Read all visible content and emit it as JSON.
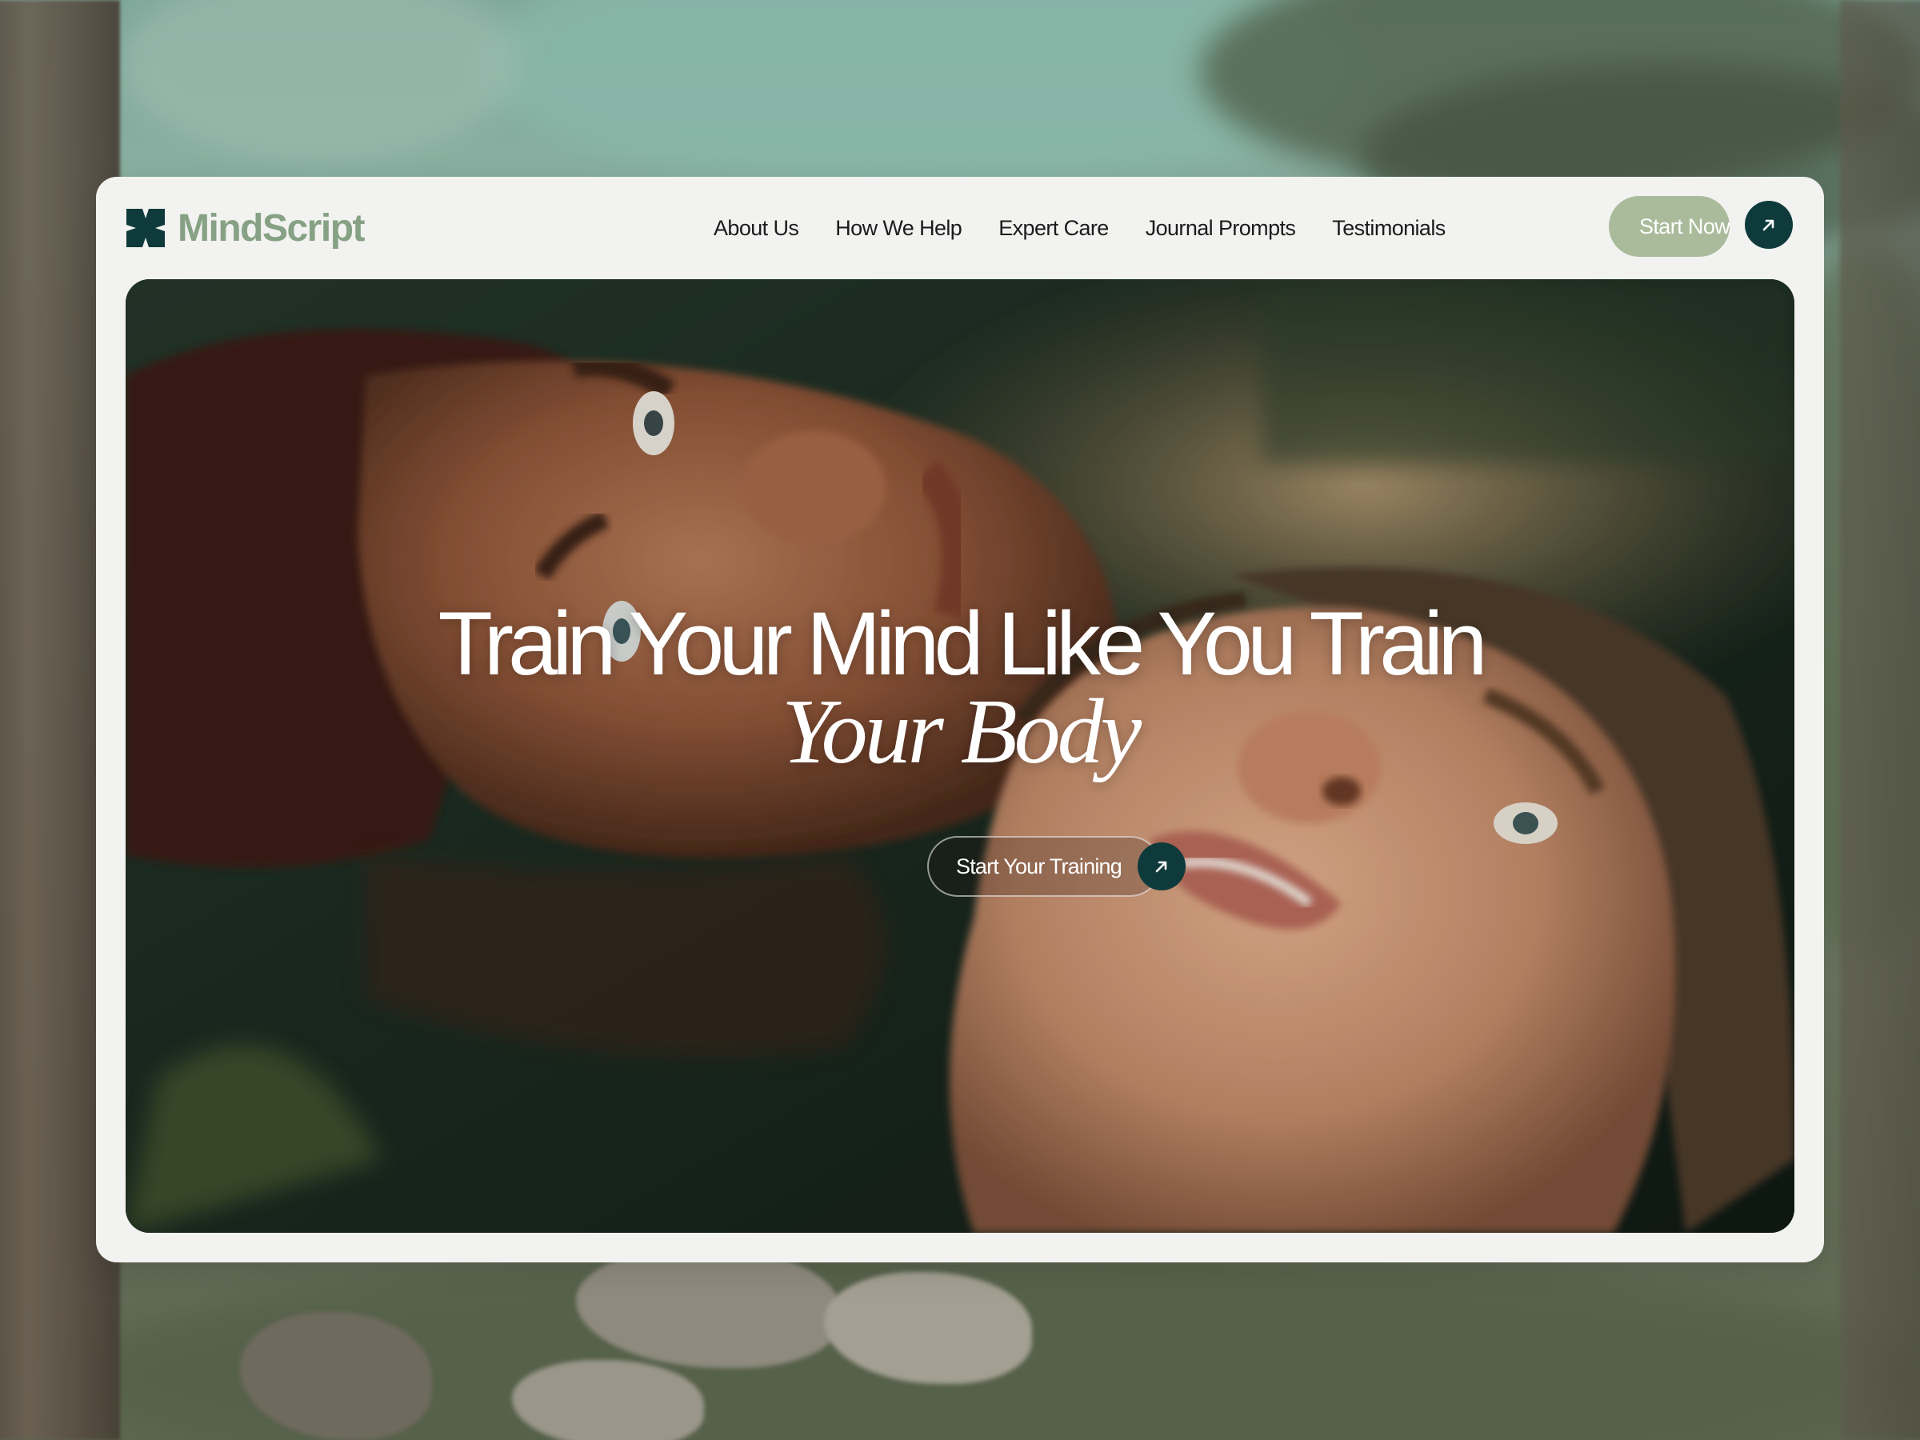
{
  "brand": {
    "name": "MindScript",
    "colors": {
      "brand_green": "#86a184",
      "accent_dark": "#0f3a3b",
      "cta_green": "#a9bb9b",
      "card_bg": "#f2f2f1"
    }
  },
  "nav": {
    "items": [
      {
        "label": "About Us"
      },
      {
        "label": "How We Help"
      },
      {
        "label": "Expert Care"
      },
      {
        "label": "Journal Prompts"
      },
      {
        "label": "Testimonials"
      }
    ]
  },
  "header_cta": {
    "label": "Start Now",
    "icon": "arrow-up-right-icon"
  },
  "hero": {
    "headline_line1": "Train Your Mind Like You Train",
    "headline_line2": "Your Body",
    "cta": {
      "label": "Start Your Training",
      "icon": "arrow-up-right-icon"
    }
  }
}
